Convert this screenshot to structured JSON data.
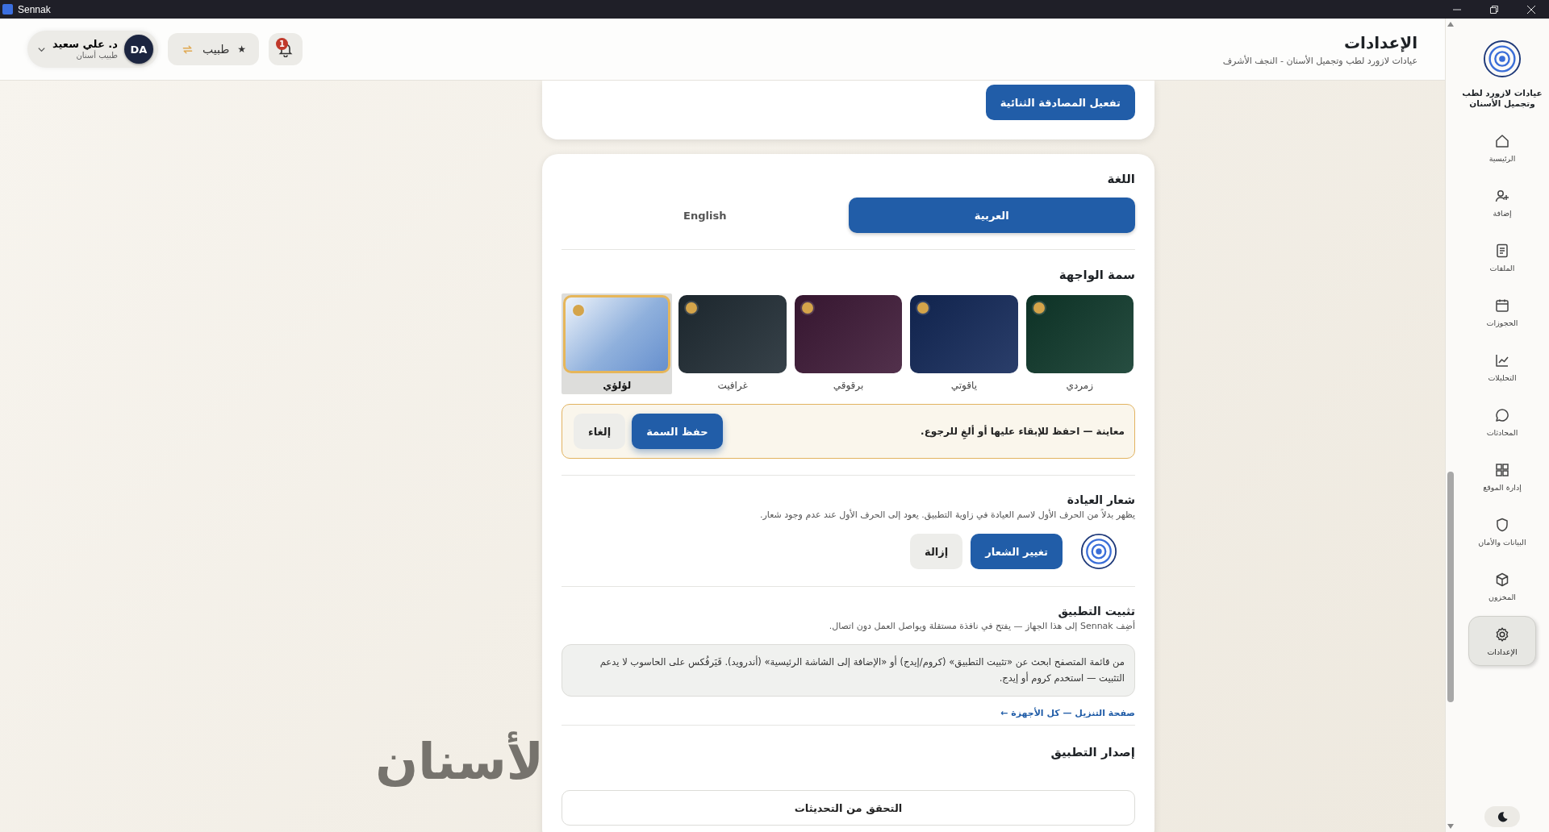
{
  "window": {
    "title": "Sennak"
  },
  "sidebar": {
    "clinic_name": "عيادات لازورد لطب وتجميل الأسنان",
    "items": [
      {
        "label": "الرئيسية",
        "selected": false
      },
      {
        "label": "إضافة",
        "selected": false
      },
      {
        "label": "الملفات",
        "selected": false
      },
      {
        "label": "الحجوزات",
        "selected": false
      },
      {
        "label": "التحليلات",
        "selected": false
      },
      {
        "label": "المحادثات",
        "selected": false
      },
      {
        "label": "إدارة الموقع",
        "selected": false
      },
      {
        "label": "البيانات والأمان",
        "selected": false
      },
      {
        "label": "المخزون",
        "selected": false
      },
      {
        "label": "الإعدادات",
        "selected": true
      }
    ]
  },
  "header": {
    "title": "الإعدادات",
    "subtitle": "عيادات لازورد لطب وتجميل الأسنان - النجف الأشرف",
    "notification_count": "1",
    "role_switch": {
      "star": "★",
      "label": "طبيب"
    },
    "user": {
      "initials": "DA",
      "name": "د. علي سعيد",
      "role": "طبيب أسنان"
    }
  },
  "security": {
    "button": "تفعيل المصادقة الثنائية"
  },
  "language": {
    "heading": "اللغة",
    "options": [
      {
        "label": "العربية",
        "selected": true
      },
      {
        "label": "English",
        "selected": false
      }
    ]
  },
  "theme": {
    "heading": "سمة الواجهة",
    "options": [
      {
        "label": "زمردي",
        "color": "#0f3a2c",
        "selected": false
      },
      {
        "label": "ياقوتي",
        "color": "#13295a",
        "selected": false
      },
      {
        "label": "برقوقي",
        "color": "#3f1a38",
        "selected": false
      },
      {
        "label": "غرافيت",
        "color": "#212d35",
        "selected": false
      },
      {
        "label": "لؤلؤي",
        "color": "#8fb0dc",
        "selected": true
      }
    ],
    "preview": {
      "text": "معاينة — احفظ للإبقاء عليها أو ألغِ للرجوع.",
      "save": "حفظ السمة",
      "cancel": "إلغاء"
    }
  },
  "clinic_logo": {
    "heading": "شعار العيادة",
    "description": "يظهر بدلاً من الحرف الأول لاسم العيادة في زاوية التطبيق. يعود إلى الحرف الأول عند عدم وجود شعار.",
    "change": "تغيير الشعار",
    "remove": "إزالة"
  },
  "install": {
    "heading": "تثبيت التطبيق",
    "description": "أضِف Sennak إلى هذا الجهاز — يفتح في نافذة مستقلة ويواصل العمل دون اتصال.",
    "note": "من قائمة المتصفح ابحث عن «تثبيت التطبيق» (كروم/إيدج) أو «الإضافة إلى الشاشة الرئيسية» (أندرويد). فَيَرفُكس على الحاسوب لا يدعم التثبيت — استخدم كروم أو إيدج.",
    "link": "صفحة التنزيل — كل الأجهزة ←"
  },
  "version": {
    "heading": "إصدار التطبيق",
    "button": "التحقق من التحديثات"
  },
  "background_text": "لأسنان"
}
